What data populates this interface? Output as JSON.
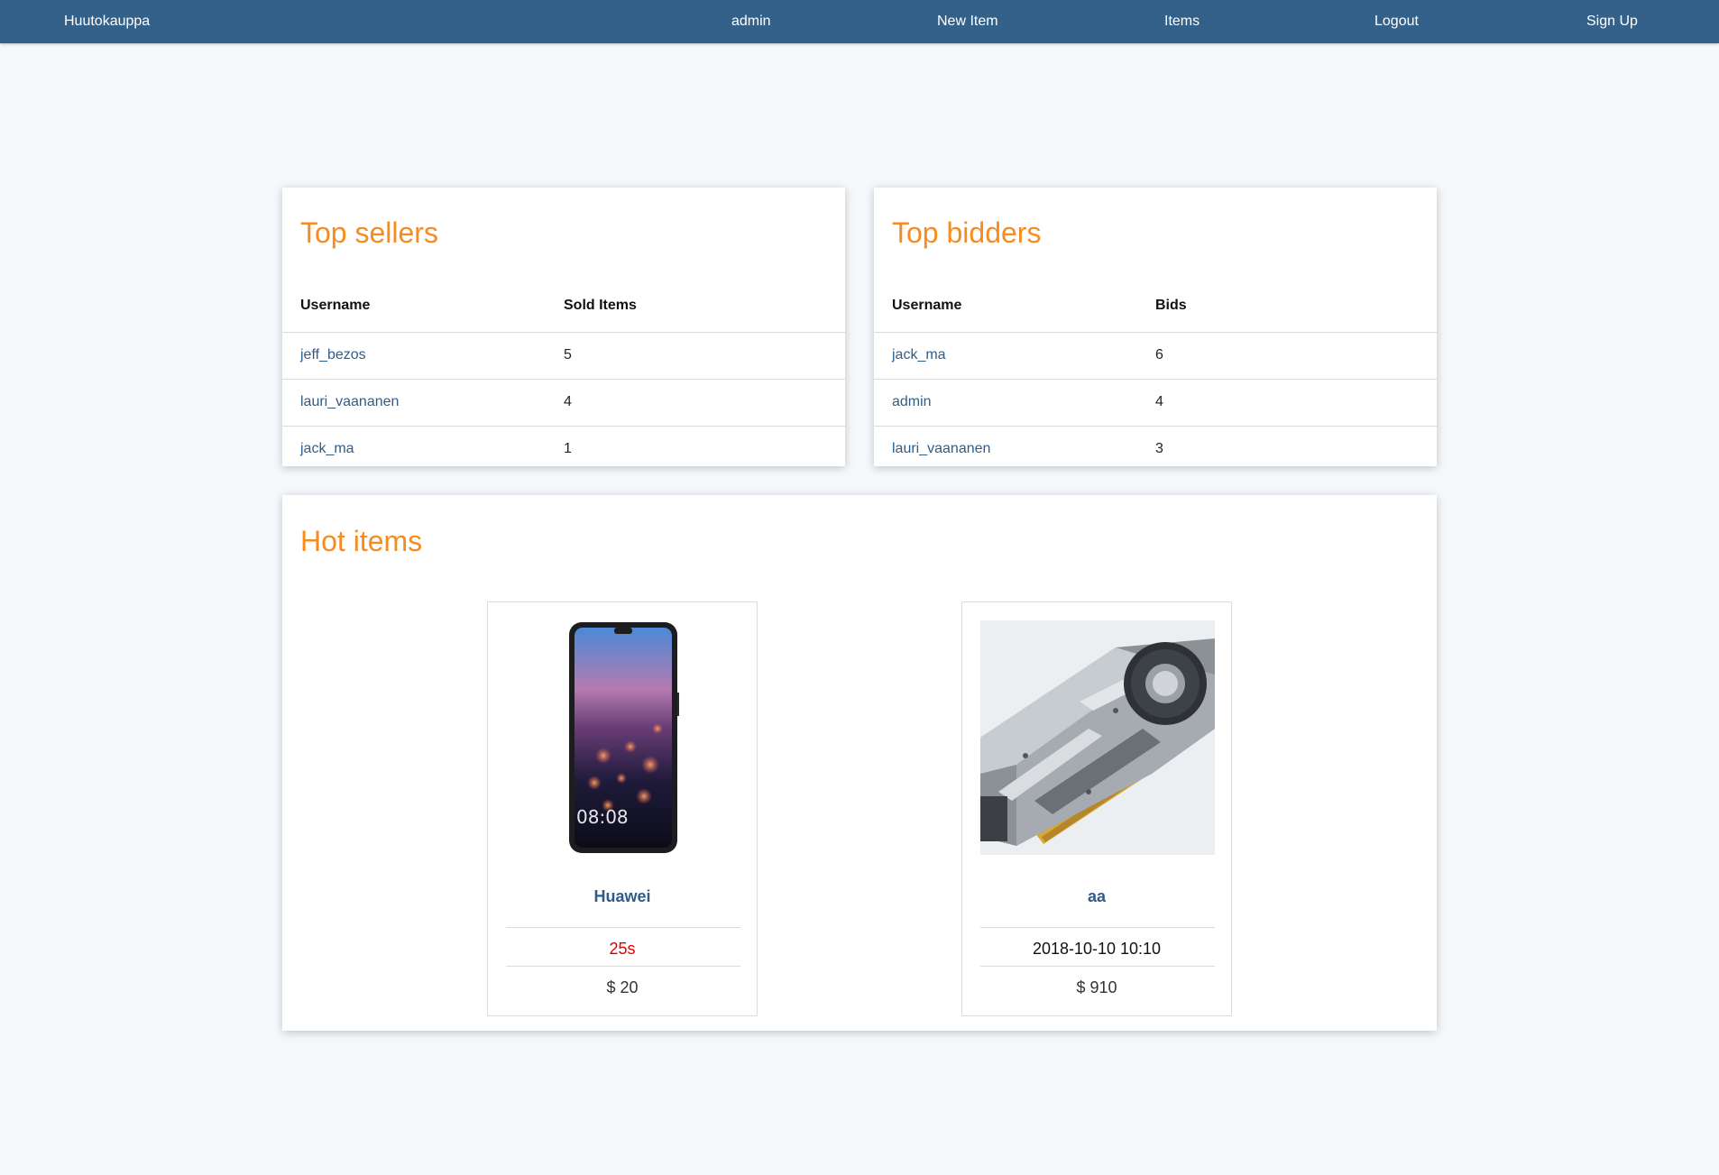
{
  "nav": {
    "brand": "Huutokauppa",
    "links": [
      "admin",
      "New Item",
      "Items",
      "Logout",
      "Sign Up"
    ]
  },
  "top_sellers": {
    "title": "Top sellers",
    "columns": [
      "Username",
      "Sold Items"
    ],
    "rows": [
      {
        "username": "jeff_bezos",
        "value": "5"
      },
      {
        "username": "lauri_vaananen",
        "value": "4"
      },
      {
        "username": "jack_ma",
        "value": "1"
      }
    ]
  },
  "top_bidders": {
    "title": "Top bidders",
    "columns": [
      "Username",
      "Bids"
    ],
    "rows": [
      {
        "username": "jack_ma",
        "value": "6"
      },
      {
        "username": "admin",
        "value": "4"
      },
      {
        "username": "lauri_vaananen",
        "value": "3"
      }
    ]
  },
  "hot_items": {
    "title": "Hot items",
    "items": [
      {
        "name": "Huawei",
        "time": "25s",
        "price": "$ 20",
        "phone_clock": "08:08",
        "time_color": "#e00000"
      },
      {
        "name": "aa",
        "time": "2018-10-10 10:10",
        "price": "$ 910",
        "time_color": "#111111"
      }
    ]
  },
  "colors": {
    "navbar": "#34618a",
    "heading": "#f68b1f",
    "link": "#2f5d8a",
    "background": "#f5f9fc"
  }
}
